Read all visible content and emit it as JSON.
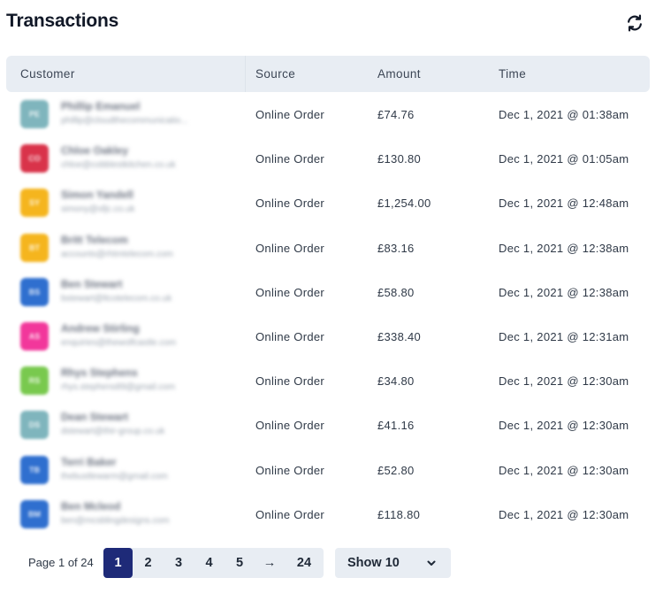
{
  "header": {
    "title": "Transactions",
    "refresh_icon": "refresh-icon"
  },
  "table": {
    "columns": [
      "Customer",
      "Source",
      "Amount",
      "Time"
    ],
    "rows": [
      {
        "initials": "PE",
        "avatar_color": "#7fb5bd",
        "name": "Phillip Emanuel",
        "email": "phillip@cloudthecommunicatio...",
        "source": "Online Order",
        "amount": "£74.76",
        "time": "Dec 1, 2021 @ 01:38am"
      },
      {
        "initials": "CO",
        "avatar_color": "#d9334a",
        "name": "Chloe Oakley",
        "email": "chloe@cobblestkitchen.co.uk",
        "source": "Online Order",
        "amount": "£130.80",
        "time": "Dec 1, 2021 @ 01:05am"
      },
      {
        "initials": "SY",
        "avatar_color": "#f5b51e",
        "name": "Simon Yandell",
        "email": "simony@sfjc.co.uk",
        "source": "Online Order",
        "amount": "£1,254.00",
        "time": "Dec 1, 2021 @ 12:48am"
      },
      {
        "initials": "BT",
        "avatar_color": "#f5b51e",
        "name": "Britt Telecom",
        "email": "accounts@rhtmtelecom.com",
        "source": "Online Order",
        "amount": "£83.16",
        "time": "Dec 1, 2021 @ 12:38am"
      },
      {
        "initials": "BS",
        "avatar_color": "#2f6fcf",
        "name": "Ben Stewart",
        "email": "bstewart@ltcotelecom.co.uk",
        "source": "Online Order",
        "amount": "£58.80",
        "time": "Dec 1, 2021 @ 12:38am"
      },
      {
        "initials": "AS",
        "avatar_color": "#f2379b",
        "name": "Andrew Stirling",
        "email": "enquiries@thewolfcastle.com",
        "source": "Online Order",
        "amount": "£338.40",
        "time": "Dec 1, 2021 @ 12:31am"
      },
      {
        "initials": "RS",
        "avatar_color": "#79c94e",
        "name": "Rhys Stephens",
        "email": "rhys.stephens89@gmail.com",
        "source": "Online Order",
        "amount": "£34.80",
        "time": "Dec 1, 2021 @ 12:30am"
      },
      {
        "initials": "DS",
        "avatar_color": "#7fb5bd",
        "name": "Dean Stewart",
        "email": "dstewart@thir-group.co.uk",
        "source": "Online Order",
        "amount": "£41.16",
        "time": "Dec 1, 2021 @ 12:30am"
      },
      {
        "initials": "TB",
        "avatar_color": "#2f6fcf",
        "name": "Terri Baker",
        "email": "thebustlewarm@gmail.com",
        "source": "Online Order",
        "amount": "£52.80",
        "time": "Dec 1, 2021 @ 12:30am"
      },
      {
        "initials": "BM",
        "avatar_color": "#2f6fcf",
        "name": "Ben Mcleod",
        "email": "ben@mcsblingdesigns.com",
        "source": "Online Order",
        "amount": "£118.80",
        "time": "Dec 1, 2021 @ 12:30am"
      }
    ]
  },
  "pagination": {
    "info": "Page 1 of 24",
    "pages": [
      "1",
      "2",
      "3",
      "4",
      "5",
      "→",
      "24"
    ],
    "active_page": "1",
    "show_label": "Show 10",
    "show_icon": "chevron-down-icon"
  },
  "colors": {
    "header_bg": "#e8edf3",
    "active_page": "#1e2a78"
  }
}
